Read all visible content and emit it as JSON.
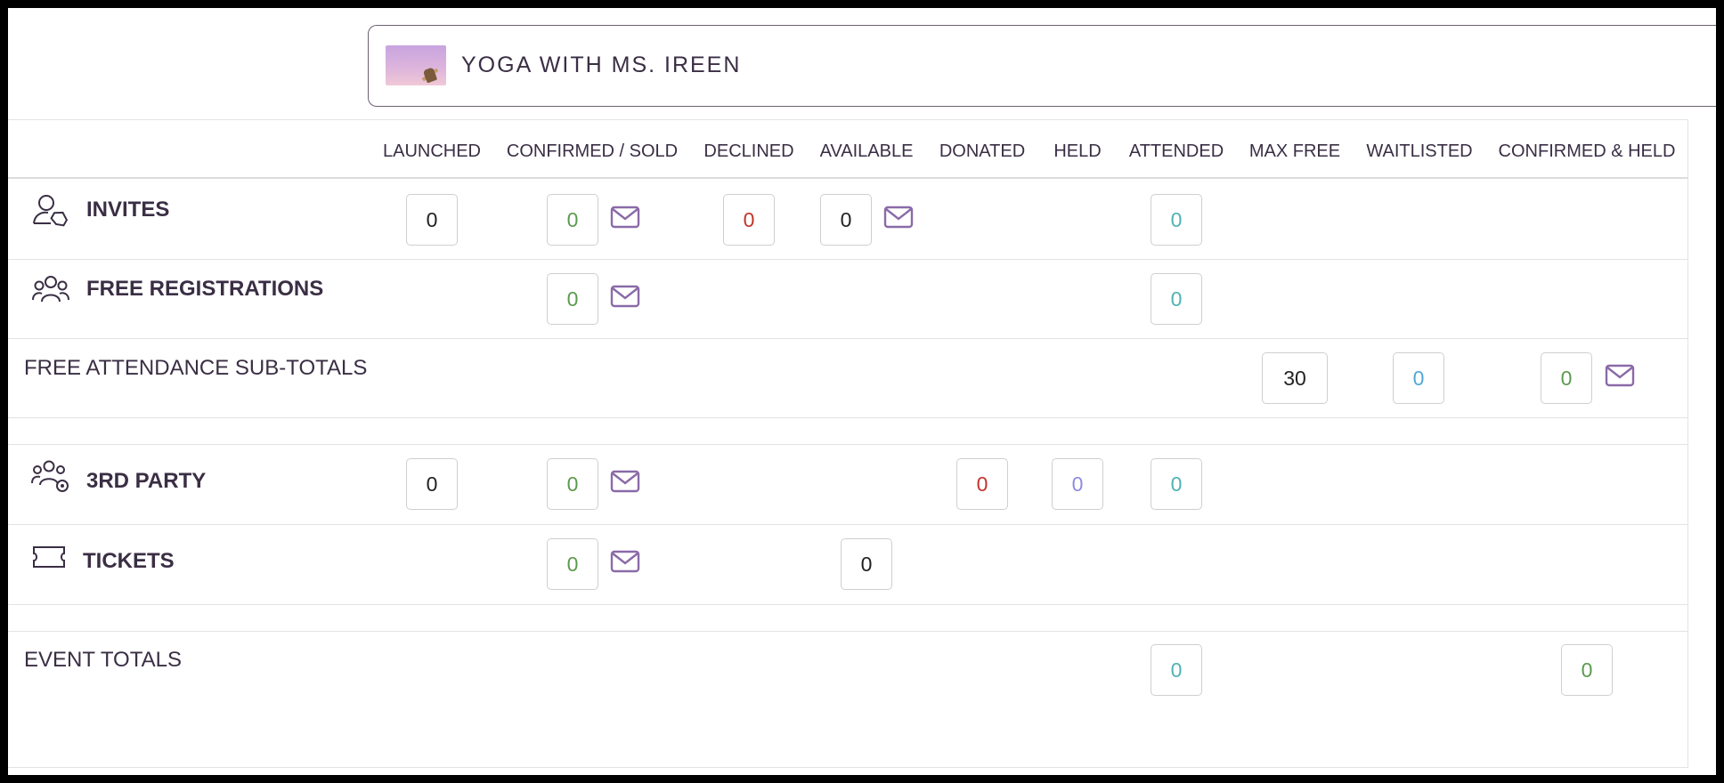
{
  "event": {
    "title": "YOGA WITH MS. IREEN",
    "thumb_icon": "event-photo-thumbnail"
  },
  "columns": [
    "LAUNCHED",
    "CONFIRMED / SOLD",
    "DECLINED",
    "AVAILABLE",
    "DONATED",
    "HELD",
    "ATTENDED",
    "MAX FREE",
    "WAITLISTED",
    "CONFIRMED & HELD"
  ],
  "rows": {
    "invites": {
      "label": "INVITES",
      "icon": "user-tag-icon",
      "launched": "0",
      "confirmed": "0",
      "declined": "0",
      "available": "0",
      "attended": "0"
    },
    "free_registrations": {
      "label": "FREE REGISTRATIONS",
      "icon": "group-icon",
      "confirmed": "0",
      "attended": "0"
    },
    "free_subtotals": {
      "label": "FREE ATTENDANCE SUB-TOTALS",
      "max_free": "30",
      "waitlisted": "0",
      "confirmed_held": "0"
    },
    "third_party": {
      "label": "3RD PARTY",
      "icon": "group-settings-icon",
      "launched": "0",
      "confirmed": "0",
      "donated": "0",
      "held": "0",
      "attended": "0"
    },
    "tickets": {
      "label": "TICKETS",
      "icon": "ticket-icon",
      "confirmed": "0",
      "available": "0"
    },
    "event_totals": {
      "label": "EVENT TOTALS",
      "attended": "0",
      "confirmed_held": "0"
    }
  },
  "colors": {
    "text": "#3a2e44",
    "accent_purple": "#8a6aa8",
    "green": "#5c9a4f",
    "red": "#c2352a",
    "teal": "#4fb3b3",
    "blue": "#4fa9d8",
    "lavender": "#8f8ce0"
  }
}
